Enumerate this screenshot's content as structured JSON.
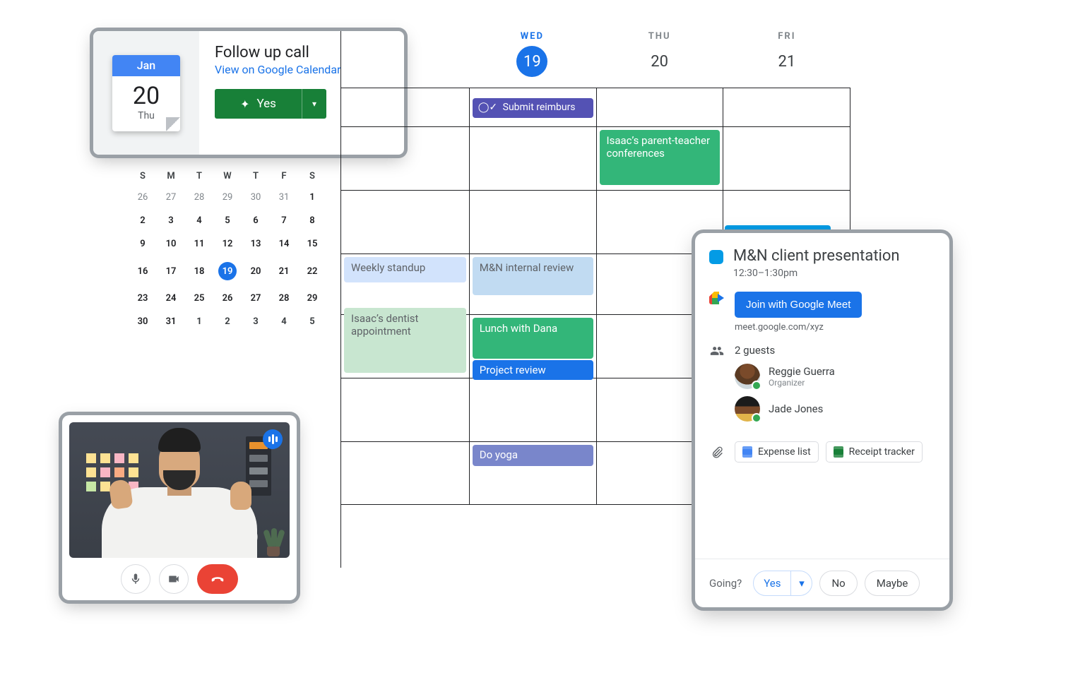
{
  "followup": {
    "month": "Jan",
    "day_num": "20",
    "day_name": "Thu",
    "title": "Follow up call",
    "link": "View on Google Calendar",
    "yes": "Yes"
  },
  "mini_calendar": {
    "dow": [
      "S",
      "M",
      "T",
      "W",
      "T",
      "F",
      "S"
    ],
    "rows": [
      [
        {
          "n": "26"
        },
        {
          "n": "27"
        },
        {
          "n": "28"
        },
        {
          "n": "29"
        },
        {
          "n": "30"
        },
        {
          "n": "31"
        },
        {
          "n": "1",
          "cur": true
        }
      ],
      [
        {
          "n": "2",
          "cur": true
        },
        {
          "n": "3",
          "cur": true
        },
        {
          "n": "4",
          "cur": true
        },
        {
          "n": "5",
          "cur": true
        },
        {
          "n": "6",
          "cur": true
        },
        {
          "n": "7",
          "cur": true
        },
        {
          "n": "8",
          "cur": true
        }
      ],
      [
        {
          "n": "9",
          "cur": true
        },
        {
          "n": "10",
          "cur": true
        },
        {
          "n": "11",
          "cur": true
        },
        {
          "n": "12",
          "cur": true
        },
        {
          "n": "13",
          "cur": true
        },
        {
          "n": "14",
          "cur": true
        },
        {
          "n": "15",
          "cur": true
        }
      ],
      [
        {
          "n": "16",
          "cur": true
        },
        {
          "n": "17",
          "cur": true
        },
        {
          "n": "18",
          "cur": true
        },
        {
          "n": "19",
          "cur": true,
          "sel": true
        },
        {
          "n": "20",
          "cur": true
        },
        {
          "n": "21",
          "cur": true
        },
        {
          "n": "22",
          "cur": true
        }
      ],
      [
        {
          "n": "23",
          "cur": true
        },
        {
          "n": "24",
          "cur": true
        },
        {
          "n": "25",
          "cur": true
        },
        {
          "n": "26",
          "cur": true
        },
        {
          "n": "27",
          "cur": true
        },
        {
          "n": "28",
          "cur": true
        },
        {
          "n": "29",
          "cur": true
        }
      ],
      [
        {
          "n": "30",
          "cur": true
        },
        {
          "n": "31",
          "cur": true
        },
        {
          "n": "1",
          "next": true
        },
        {
          "n": "2",
          "next": true
        },
        {
          "n": "3",
          "next": true
        },
        {
          "n": "4",
          "next": true
        },
        {
          "n": "5",
          "next": true
        }
      ]
    ]
  },
  "week": {
    "days": [
      {
        "dow": "WED",
        "num": "19",
        "active": true
      },
      {
        "dow": "THU",
        "num": "20"
      },
      {
        "dow": "FRI",
        "num": "21"
      }
    ],
    "events": {
      "submit": "Submit reimburs",
      "parent_teacher": "Isaac’s parent-teacher conferences",
      "standup": "Weekly standup",
      "internal": "M&N internal review",
      "dentist": "Isaac’s dentist appointment",
      "lunch": "Lunch with Dana",
      "project": "Project review",
      "yoga": "Do yoga"
    }
  },
  "panel": {
    "title": "M&N client presentation",
    "time": "12:30–1:30pm",
    "join": "Join with Google Meet",
    "meet_url": "meet.google.com/xyz",
    "guests_label": "2 guests",
    "guests": [
      {
        "name": "Reggie Guerra",
        "role": "Organizer"
      },
      {
        "name": "Jade Jones",
        "role": ""
      }
    ],
    "attachments": [
      "Expense list",
      "Receipt tracker"
    ],
    "going": "Going?",
    "rsvp": {
      "yes": "Yes",
      "no": "No",
      "maybe": "Maybe"
    }
  }
}
